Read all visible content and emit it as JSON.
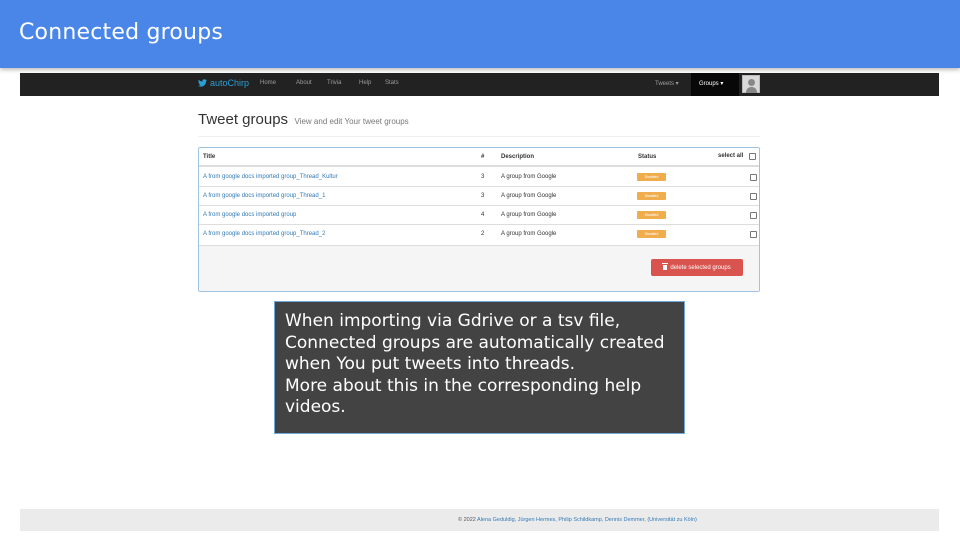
{
  "slide": {
    "title": "Connected groups"
  },
  "navbar": {
    "brand": "autoChirp",
    "links": [
      "Home",
      "About",
      "Trivia",
      "Help",
      "Stats"
    ],
    "tweets_dropdown": "Tweets ▾",
    "groups_dropdown": "Groups ▾"
  },
  "page": {
    "heading": "Tweet groups",
    "subheading": "View and edit Your tweet groups"
  },
  "table": {
    "headers": {
      "title": "Title",
      "num": "#",
      "description": "Description",
      "status": "Status",
      "select_all": "select all"
    },
    "rows": [
      {
        "title": "A from google docs imported group_Thread_Kultur",
        "num": "3",
        "description": "A group from Google",
        "status": "Disabled"
      },
      {
        "title": "A from google docs imported group_Thread_1",
        "num": "3",
        "description": "A group from Google",
        "status": "Disabled"
      },
      {
        "title": "A from google docs imported group",
        "num": "4",
        "description": "A group from Google",
        "status": "Disabled"
      },
      {
        "title": "A from google docs imported group_Thread_2",
        "num": "2",
        "description": "A group from Google",
        "status": "Disabled"
      }
    ],
    "delete_button": "delete selected groups"
  },
  "footer": {
    "prefix": "© 2022 ",
    "names": "Alena Geduldig, Jürgen Hermes, Philip Schildkamp, Dennis Demmer, (Universität zu Köln)"
  },
  "note": {
    "lines": [
      "When importing via Gdrive or a tsv file,",
      "Connected groups are automatically created",
      "when You put tweets into threads.",
      "More about this in the corresponding help",
      "videos."
    ]
  },
  "colors": {
    "slide_header": "#4a86e8",
    "navbar": "#222222",
    "brand": "#2a9fd6",
    "badge_warning": "#f0ad4e",
    "danger_button": "#d9534f",
    "link": "#337ab7",
    "note_background": "#434343"
  }
}
